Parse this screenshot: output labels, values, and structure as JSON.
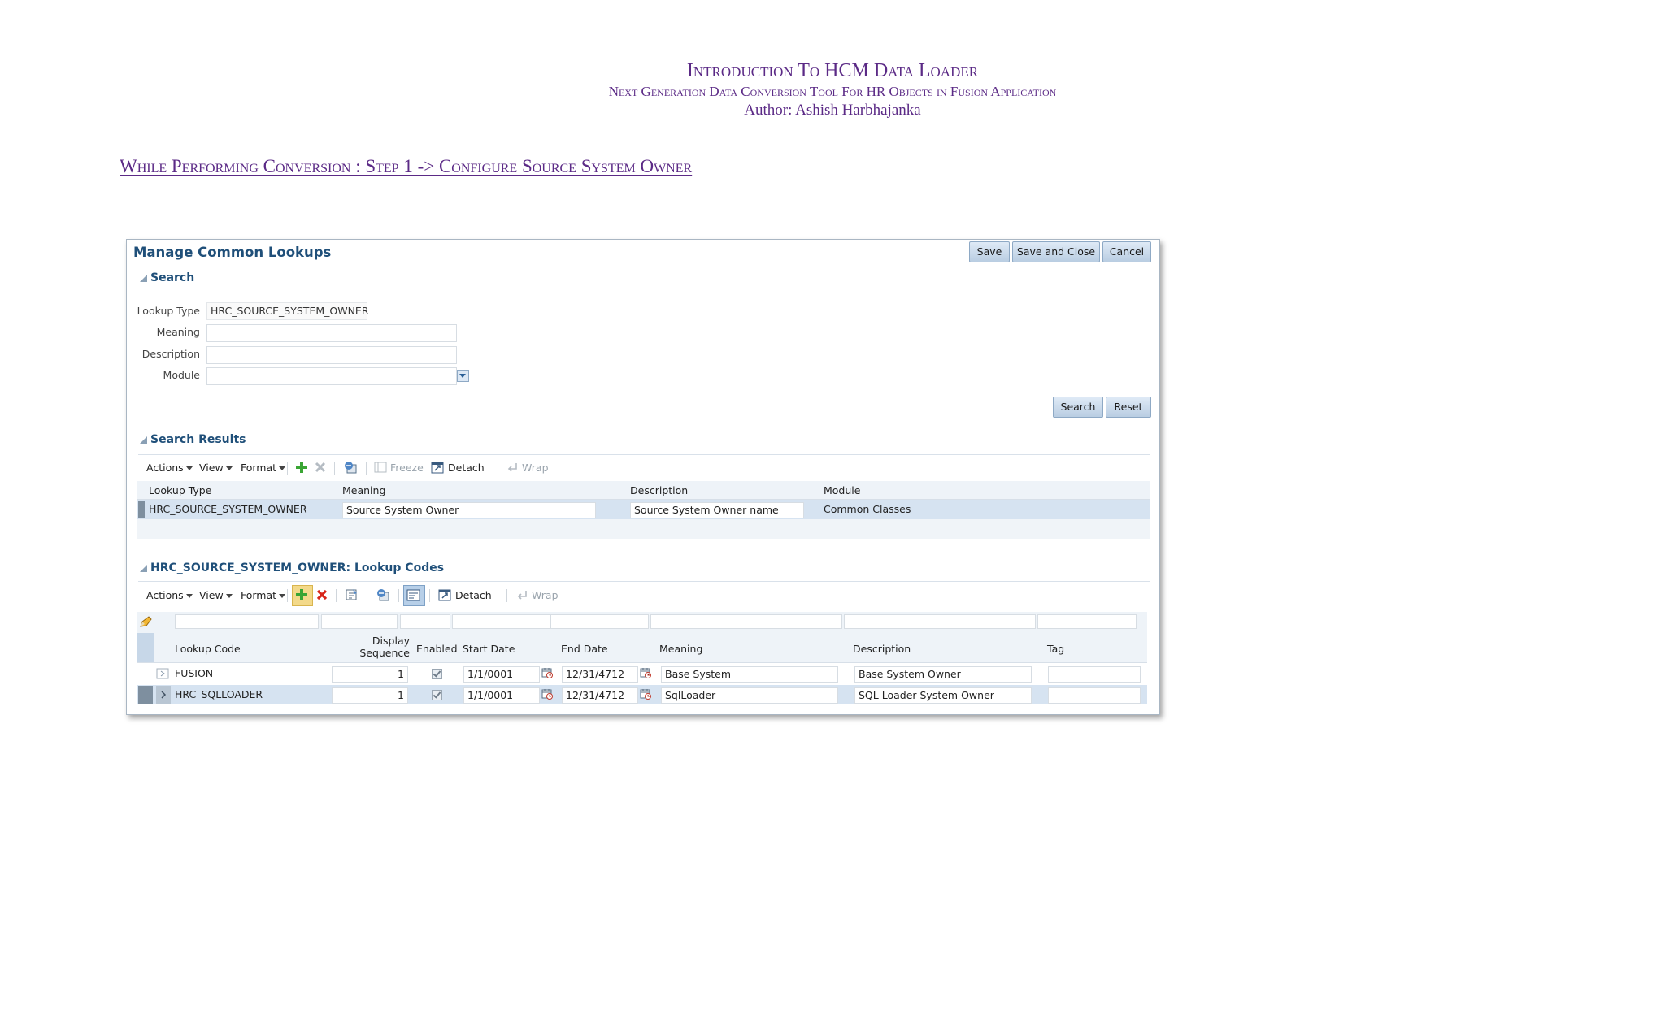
{
  "document": {
    "title": "Introduction To HCM Data Loader",
    "subtitle": "Next Generation Data Conversion Tool For HR Objects in Fusion Application",
    "author": "Author: Ashish Harbhajanka",
    "section_heading": "While Performing Conversion : Step 1 -> Configure Source System Owner"
  },
  "app": {
    "page_title": "Manage Common Lookups",
    "buttons": {
      "save": "Save",
      "save_close": "Save and Close",
      "cancel": "Cancel"
    },
    "search": {
      "title": "Search",
      "lookup_type_label": "Lookup Type",
      "lookup_type_value": "HRC_SOURCE_SYSTEM_OWNER",
      "meaning_label": "Meaning",
      "description_label": "Description",
      "module_label": "Module",
      "search_button": "Search",
      "reset_button": "Reset"
    },
    "results": {
      "title": "Search Results",
      "toolbar": {
        "actions": "Actions",
        "view": "View",
        "format": "Format",
        "freeze": "Freeze",
        "detach": "Detach",
        "wrap": "Wrap"
      },
      "columns": [
        "Lookup Type",
        "Meaning",
        "Description",
        "Module"
      ],
      "row": {
        "lookup_type": "HRC_SOURCE_SYSTEM_OWNER",
        "meaning": "Source System Owner",
        "description": "Source System Owner name",
        "module": "Common Classes"
      }
    },
    "codes": {
      "title": "HRC_SOURCE_SYSTEM_OWNER: Lookup Codes",
      "toolbar": {
        "actions": "Actions",
        "view": "View",
        "format": "Format",
        "detach": "Detach",
        "wrap": "Wrap"
      },
      "columns": {
        "lookup_code": "Lookup Code",
        "display_seq_1": "Display",
        "display_seq_2": "Sequence",
        "enabled": "Enabled",
        "start_date": "Start Date",
        "end_date": "End Date",
        "meaning": "Meaning",
        "description": "Description",
        "tag": "Tag"
      },
      "rows": [
        {
          "code": "FUSION",
          "seq": "1",
          "start": "1/1/0001",
          "end": "12/31/4712",
          "meaning": "Base System",
          "description": "Base System Owner",
          "tag": ""
        },
        {
          "code": "HRC_SQLLOADER",
          "seq": "1",
          "start": "1/1/0001",
          "end": "12/31/4712",
          "meaning": "SqlLoader",
          "description": "SQL Loader System Owner",
          "tag": ""
        }
      ]
    }
  }
}
